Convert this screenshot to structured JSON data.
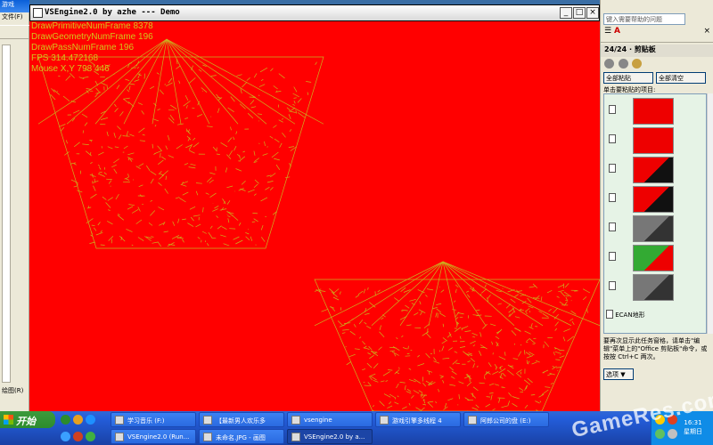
{
  "word_bg": {
    "title": "游戏",
    "menu_file": "文件(F)",
    "status": "绘图(R)"
  },
  "engine": {
    "title": "VSEngine2.0 by azhe --- Demo",
    "btn_min": "_",
    "btn_max": "□",
    "btn_close": "×",
    "stats": [
      "DrawPrimitiveNumFrame 8378",
      "DrawGeometryNumFrame 196",
      "DrawPassNumFrame 196",
      "FPS 314.472168",
      "Mouse X,Y 798 446"
    ],
    "colors": {
      "viewport_bg": "#ff0000",
      "wire": "#c9b31f"
    }
  },
  "pane": {
    "help_placeholder": "键入需要帮助的问题",
    "header": "24/24 · 剪贴板",
    "paste_all": "全部粘贴",
    "clear_all": "全部清空",
    "click_label": "单击要粘贴的项目:",
    "text_clip": "ECAN地形",
    "note": "要再次显示此任务窗格，请单击\"编辑\"菜单上的\"Office 剪贴板\"命令，或按按 Ctrl+C 两次。",
    "options": "选项 ▼",
    "clips": [
      "red",
      "red",
      "red-black",
      "red-black",
      "gray",
      "green-red",
      "gray"
    ]
  },
  "taskbar": {
    "start": "开始",
    "row1": [
      {
        "label": "学习音乐 (F:)",
        "icon": "music-icon"
      },
      {
        "label": "【最新男人欢乐多",
        "icon": "ie-icon"
      },
      {
        "label": "vsengine",
        "icon": "folder-icon"
      },
      {
        "label": "游戏引擎多线程 4",
        "icon": "doc-icon"
      },
      {
        "label": "阿郎公司的盘 (E:)",
        "icon": "drive-icon"
      }
    ],
    "row2": [
      {
        "label": "VSEngine2.0 (Run...",
        "icon": "app-icon"
      },
      {
        "label": "未命名.JPG - 画图",
        "icon": "paint-icon"
      },
      {
        "label": "VSEngine2.0 by a...",
        "icon": "app-icon",
        "active": true
      }
    ],
    "clock_time": "16:31",
    "clock_day": "星期日",
    "watermark": "GameRes.com"
  }
}
